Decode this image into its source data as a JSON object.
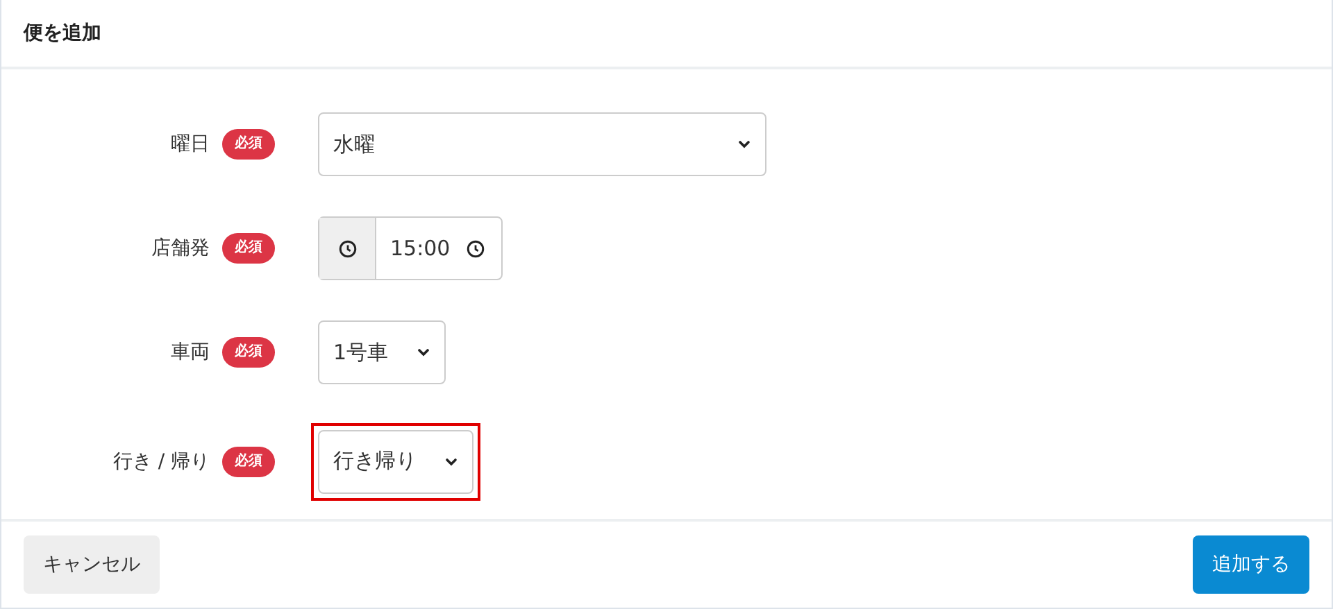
{
  "dialog": {
    "title": "便を追加"
  },
  "fields": [
    {
      "label": "曜日",
      "badge": "必須",
      "kind": "select",
      "value": "水曜",
      "full_width": true,
      "highlighted": false
    },
    {
      "label": "店舗発",
      "badge": "必須",
      "kind": "time",
      "value": "15:00",
      "full_width": false,
      "highlighted": false
    },
    {
      "label": "車両",
      "badge": "必須",
      "kind": "select",
      "value": "1号車",
      "full_width": false,
      "highlighted": false
    },
    {
      "label": "行き / 帰り",
      "badge": "必須",
      "kind": "select",
      "value": "行き帰り",
      "full_width": false,
      "highlighted": true
    }
  ],
  "buttons": [
    {
      "label": "キャンセル",
      "kind": "secondary"
    },
    {
      "label": "追加する",
      "kind": "primary"
    }
  ]
}
